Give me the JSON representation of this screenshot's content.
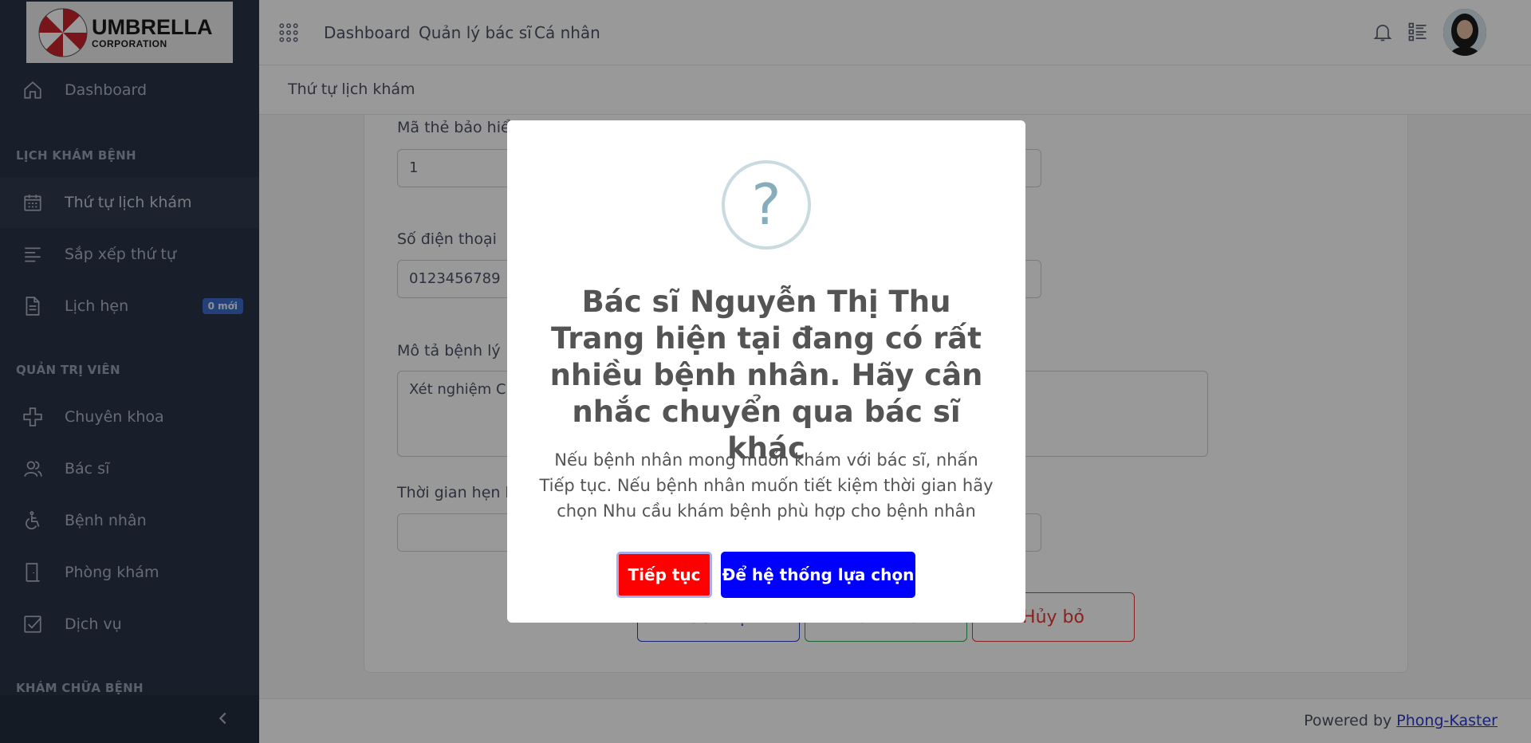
{
  "app": {
    "logo_line1": "UMBRELLA",
    "logo_line2": "CORPORATION"
  },
  "sidebar": {
    "items": [
      {
        "label": "Dashboard",
        "icon": "home-icon"
      },
      {
        "label": "Thứ tự lịch khám",
        "icon": "calendar-icon",
        "active": true
      },
      {
        "label": "Sắp xếp thứ tự",
        "icon": "align-left-icon"
      },
      {
        "label": "Lịch hẹn",
        "icon": "file-icon",
        "badge": "0 mới"
      },
      {
        "label": "Chuyên khoa",
        "icon": "plus-icon"
      },
      {
        "label": "Bác sĩ",
        "icon": "users-icon"
      },
      {
        "label": "Bệnh nhân",
        "icon": "wheelchair-icon"
      },
      {
        "label": "Phòng khám",
        "icon": "door-icon"
      },
      {
        "label": "Dịch vụ",
        "icon": "checkbox-icon"
      }
    ],
    "sections": {
      "appointments": "LỊCH KHÁM BỆNH",
      "admin": "QUẢN TRỊ VIÊN",
      "treatment": "KHÁM CHỮA BỆNH"
    }
  },
  "topnav": {
    "links": [
      "Dashboard",
      "Quản lý bác sĩ",
      "Cá nhân"
    ]
  },
  "breadcrumb": "Thứ tự lịch khám",
  "form": {
    "insurance_label": "Mã thẻ bảo hiể",
    "insurance_value": "1",
    "phone_label": "Số điện thoại",
    "phone_value": "0123456789",
    "desc_label": "Mô tả bệnh lý",
    "desc_value": "Xét nghiệm C",
    "time_label": "Thời gian hẹn k",
    "time_value": "",
    "btn_confirm": "Xác nhận",
    "btn_reset": "Làm mới",
    "btn_cancel": "Hủy bỏ"
  },
  "footer": {
    "prefix": "Powered by",
    "link": "Phong-Kaster"
  },
  "modal": {
    "title": "Bác sĩ Nguyễn Thị Thu Trang hiện tại đang có rất nhiều bệnh nhân. Hãy cân nhắc chuyển qua bác sĩ khác",
    "text": "Nếu bệnh nhân mong muốn khám với bác sĩ, nhấn Tiếp tục. Nếu bệnh nhân muốn tiết kiệm thời gian hãy chọn Nhu cầu khám bệnh phù hợp cho bệnh nhân",
    "btn_continue": "Tiếp tục",
    "btn_system": "Để hệ thống lựa chọn",
    "icon": "question-icon"
  },
  "colors": {
    "sidebar_bg": "#293548",
    "continue_btn": "#ff0000",
    "system_btn": "#0000ff",
    "link": "#2a39c8"
  }
}
